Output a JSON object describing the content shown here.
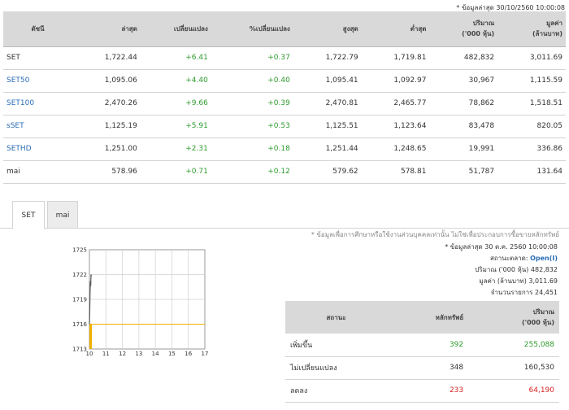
{
  "last_update": "* ข้อมูลล่าสุด 30/10/2560 10:00:08",
  "market_table": {
    "headers": {
      "name": "ดัชนี",
      "last": "ล่าสุด",
      "change": "เปลี่ยนแปลง",
      "pct_change": "%เปลี่ยนแปลง",
      "high": "สูงสุด",
      "low": "ต่ำสุด",
      "volume_line1": "ปริมาณ",
      "volume_line2": "('000 หุ้น)",
      "value_line1": "มูลค่า",
      "value_line2": "(ล้านบาท)"
    },
    "rows": [
      {
        "name": "SET",
        "last": "1,722.44",
        "change": "+6.41",
        "pct": "+0.37",
        "high": "1,722.79",
        "low": "1,719.81",
        "volume": "482,832",
        "value": "3,011.69"
      },
      {
        "name": "SET50",
        "last": "1,095.06",
        "change": "+4.40",
        "pct": "+0.40",
        "high": "1,095.41",
        "low": "1,092.97",
        "volume": "30,967",
        "value": "1,115.59"
      },
      {
        "name": "SET100",
        "last": "2,470.26",
        "change": "+9.66",
        "pct": "+0.39",
        "high": "2,470.81",
        "low": "2,465.77",
        "volume": "78,862",
        "value": "1,518.51"
      },
      {
        "name": "sSET",
        "last": "1,125.19",
        "change": "+5.91",
        "pct": "+0.53",
        "high": "1,125.51",
        "low": "1,123.64",
        "volume": "83,478",
        "value": "820.05"
      },
      {
        "name": "SETHD",
        "last": "1,251.00",
        "change": "+2.31",
        "pct": "+0.18",
        "high": "1,251.44",
        "low": "1,248.65",
        "volume": "19,991",
        "value": "336.86"
      },
      {
        "name": "mai",
        "last": "578.96",
        "change": "+0.71",
        "pct": "+0.12",
        "high": "579.62",
        "low": "578.81",
        "volume": "51,787",
        "value": "131.64"
      }
    ]
  },
  "tabs": [
    {
      "label": "SET",
      "active": true
    },
    {
      "label": "mai",
      "active": false
    }
  ],
  "chart_data": {
    "type": "line",
    "x_ticks": [
      "10",
      "11",
      "12",
      "13",
      "14",
      "15",
      "16",
      "17"
    ],
    "y_ticks": [
      "1713",
      "1716",
      "1719",
      "1722",
      "1725"
    ],
    "ylim": [
      1713,
      1725
    ],
    "xlim": [
      10,
      17
    ],
    "baseline": 1716,
    "line_color": "#555555",
    "fill_color": "#f0b000",
    "points": [
      [
        10,
        1716.0
      ],
      [
        10.02,
        1717.5
      ],
      [
        10.04,
        1719.8
      ],
      [
        10.06,
        1721.2
      ],
      [
        10.08,
        1720.6
      ],
      [
        10.1,
        1722.0
      ],
      [
        10.12,
        1721.8
      ]
    ]
  },
  "info": {
    "disclaimer": "* ข้อมูลเพื่อการศึกษาหรือใช้งานส่วนบุคคลเท่านั้น ไม่ใช่เพื่อประกอบการซื้อขายหลักทรัพย์",
    "updated": "* ข้อมูลล่าสุด 30 ต.ค. 2560 10:00:08",
    "market_status_label": "สถานะตลาด:",
    "market_status_value": "Open(I)",
    "volume_label": "ปริมาณ ('000 หุ้น)",
    "volume_value": "482,832",
    "value_label": "มูลค่า (ล้านบาท)",
    "value_value": "3,011.69",
    "deals_label": "จำนวนรายการ",
    "deals_value": "24,451"
  },
  "status_table": {
    "headers": {
      "status": "สถานะ",
      "securities": "หลักทรัพย์",
      "volume_line1": "ปริมาณ",
      "volume_line2": "('000 หุ้น)"
    },
    "rows": [
      {
        "label": "เพิ่มขึ้น",
        "count": "392",
        "volume": "255,088",
        "color": "#2e9a2e"
      },
      {
        "label": "ไม่เปลี่ยนแปลง",
        "count": "348",
        "volume": "160,530",
        "color": "#333333"
      },
      {
        "label": "ลดลง",
        "count": "233",
        "volume": "64,190",
        "color": "#d62424"
      }
    ]
  }
}
